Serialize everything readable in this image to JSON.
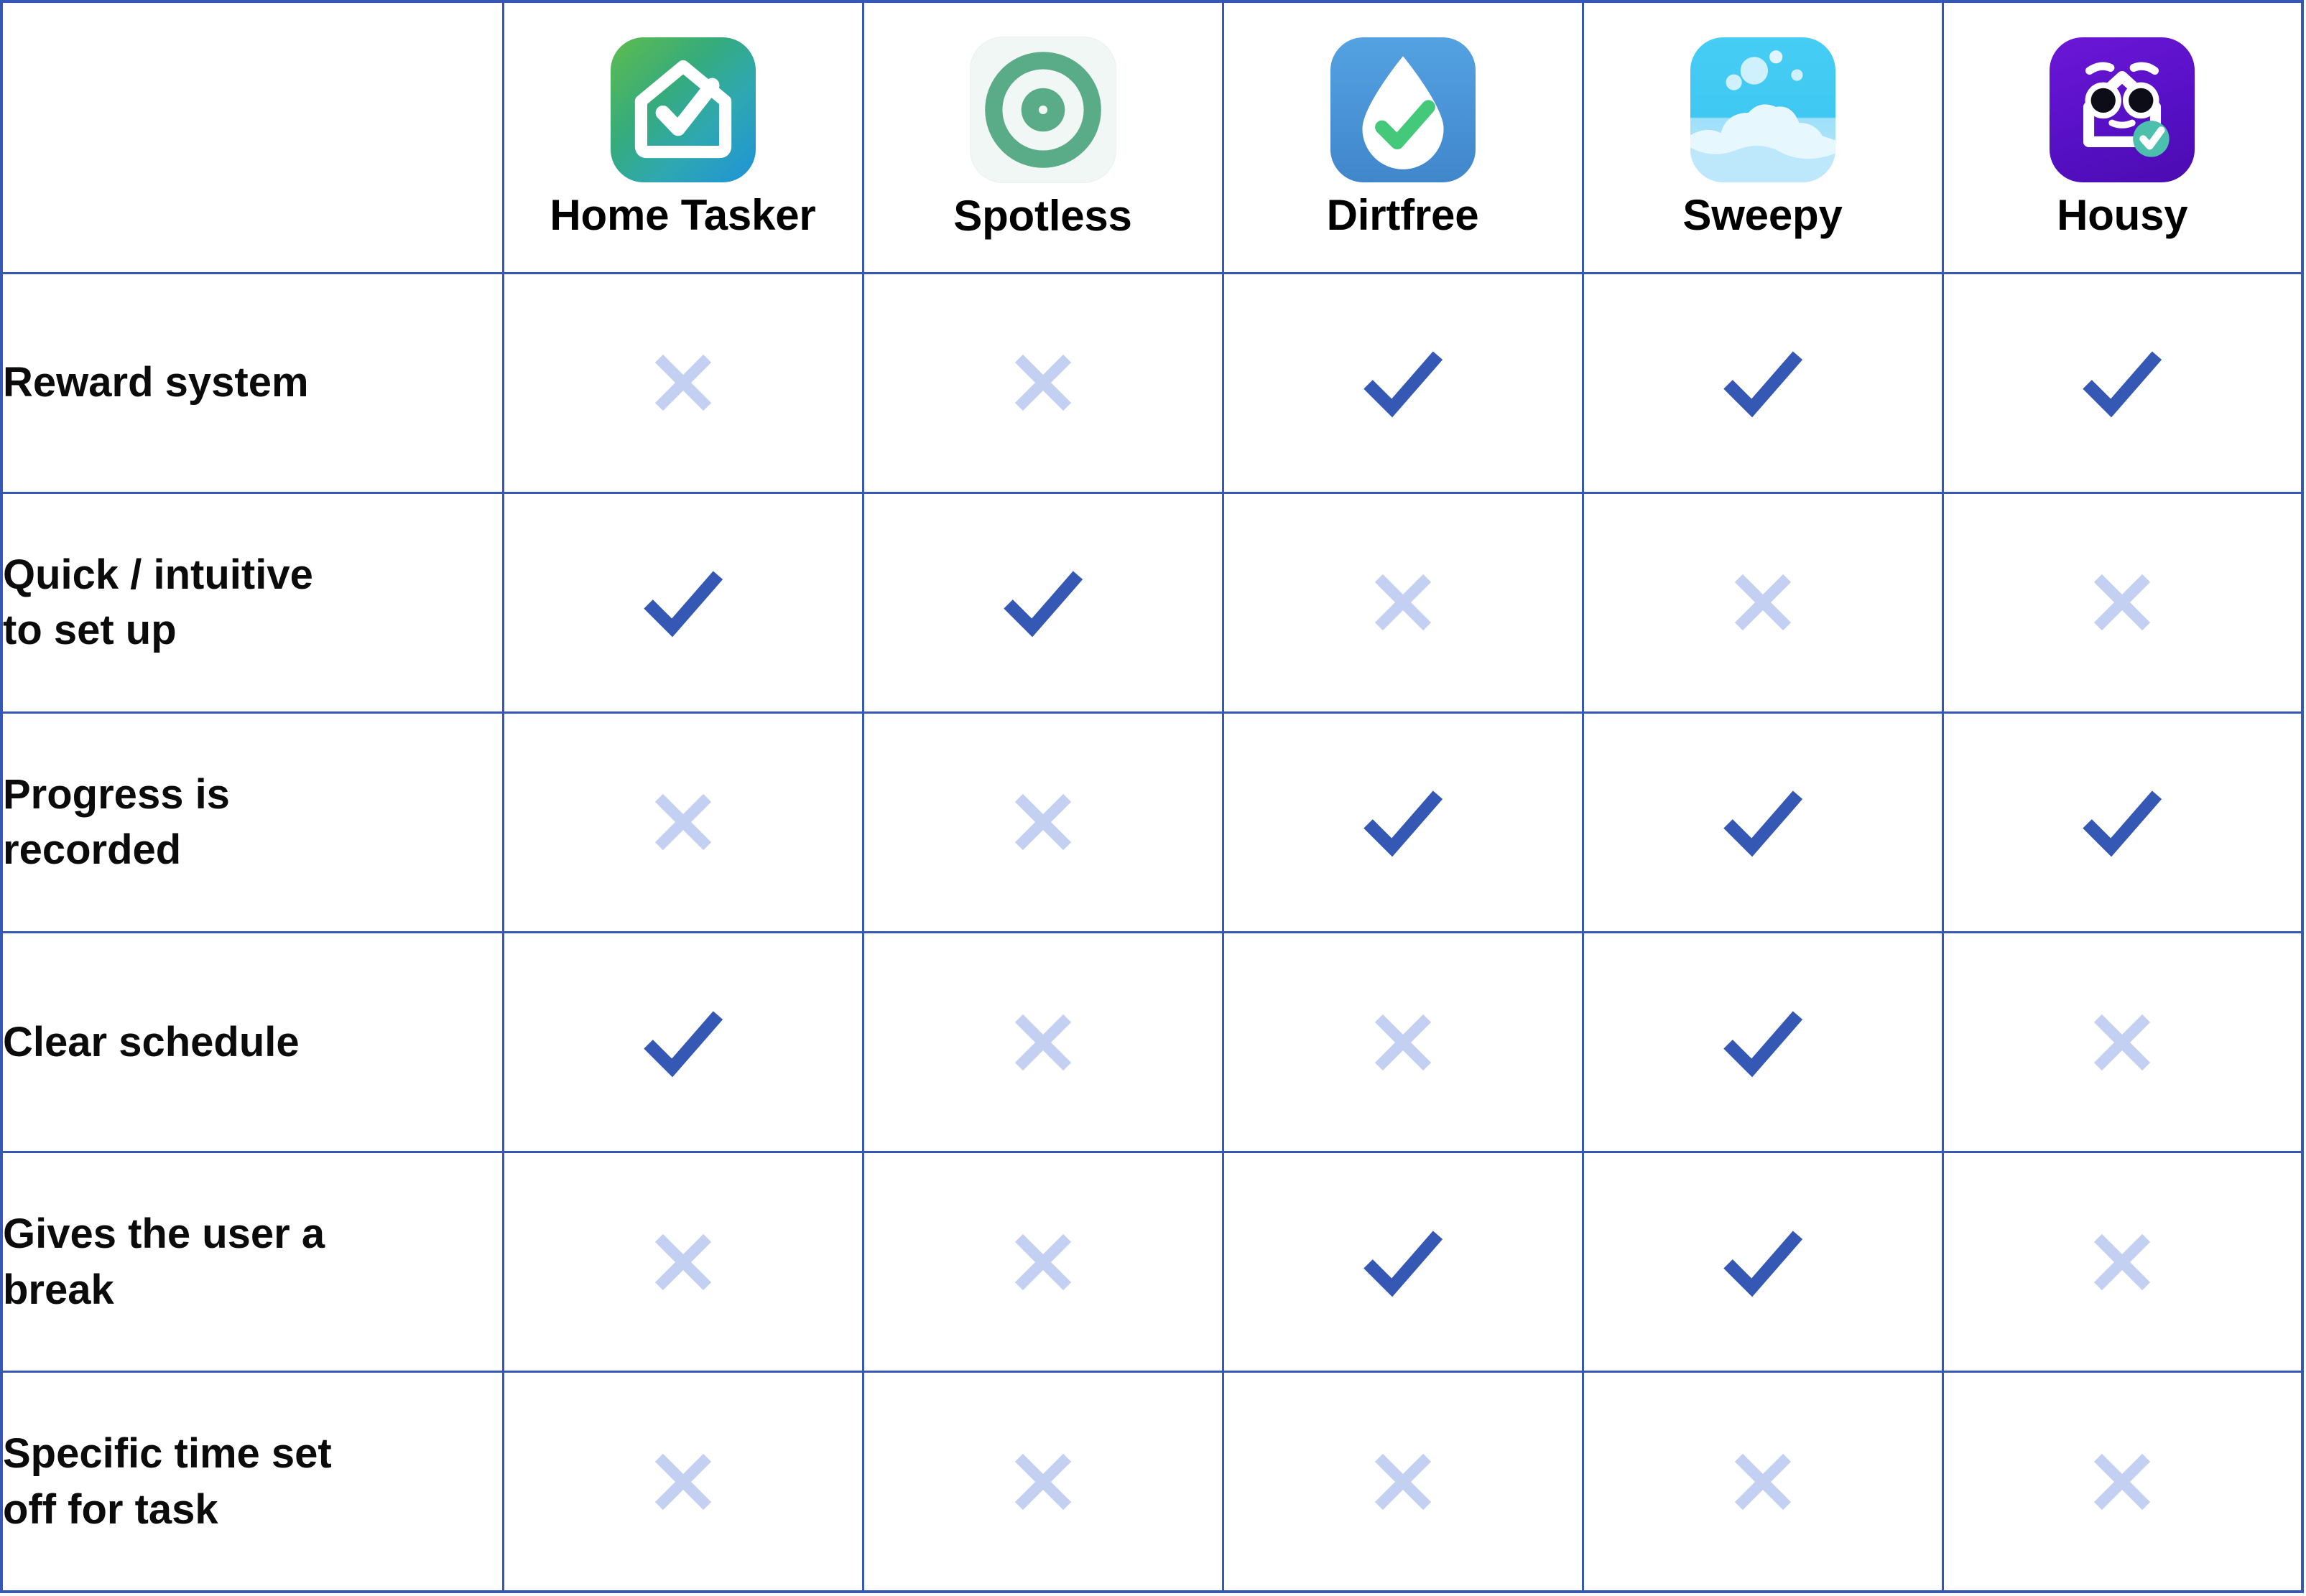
{
  "table": {
    "kind": "feature-comparison-matrix",
    "accent_color": "#3558b5",
    "check_color": "#3458b4",
    "cross_color": "#c3d0f2",
    "corner_label": "",
    "columns": [
      {
        "id": "home-tasker",
        "label": "Home Tasker",
        "icon": "home-tasker-app-icon",
        "icon_colors": [
          "#5fbd4e",
          "#2fa8b0",
          "#1f93d8"
        ]
      },
      {
        "id": "spotless",
        "label": "Spotless",
        "icon": "spotless-app-icon",
        "icon_colors": [
          "#f1f7f4",
          "#5aab87"
        ]
      },
      {
        "id": "dirtfree",
        "label": "Dirtfree",
        "icon": "dirtfree-app-icon",
        "icon_colors": [
          "#54a2e2",
          "#ffffff",
          "#44c97a"
        ]
      },
      {
        "id": "sweepy",
        "label": "Sweepy",
        "icon": "sweepy-app-icon",
        "icon_colors": [
          "#46cdf4",
          "#ffffff",
          "#cdeffd"
        ]
      },
      {
        "id": "housy",
        "label": "Housy",
        "icon": "housy-app-icon",
        "icon_colors": [
          "#6c17d6",
          "#ffffff",
          "#4cbfad"
        ]
      }
    ],
    "rows": [
      {
        "id": "reward-system",
        "label_line1": "Reward system",
        "label_line2": "",
        "values": [
          "cross",
          "cross",
          "check",
          "check",
          "check"
        ]
      },
      {
        "id": "quick-intuitive-to-set-up",
        "label_line1": "Quick / intuitive",
        "label_line2": "to set up",
        "values": [
          "check",
          "check",
          "cross",
          "cross",
          "cross"
        ]
      },
      {
        "id": "progress-is-recorded",
        "label_line1": "Progress is",
        "label_line2": "recorded",
        "values": [
          "cross",
          "cross",
          "check",
          "check",
          "check"
        ]
      },
      {
        "id": "clear-schedule",
        "label_line1": "Clear schedule",
        "label_line2": "",
        "values": [
          "check",
          "cross",
          "cross",
          "check",
          "cross"
        ]
      },
      {
        "id": "gives-the-user-a-break",
        "label_line1": "Gives the user a",
        "label_line2": "break",
        "values": [
          "cross",
          "cross",
          "check",
          "check",
          "cross"
        ]
      },
      {
        "id": "specific-time-set-off-for-task",
        "label_line1": "Specific time set",
        "label_line2": "off for task",
        "values": [
          "cross",
          "cross",
          "cross",
          "cross",
          "cross"
        ]
      }
    ]
  }
}
